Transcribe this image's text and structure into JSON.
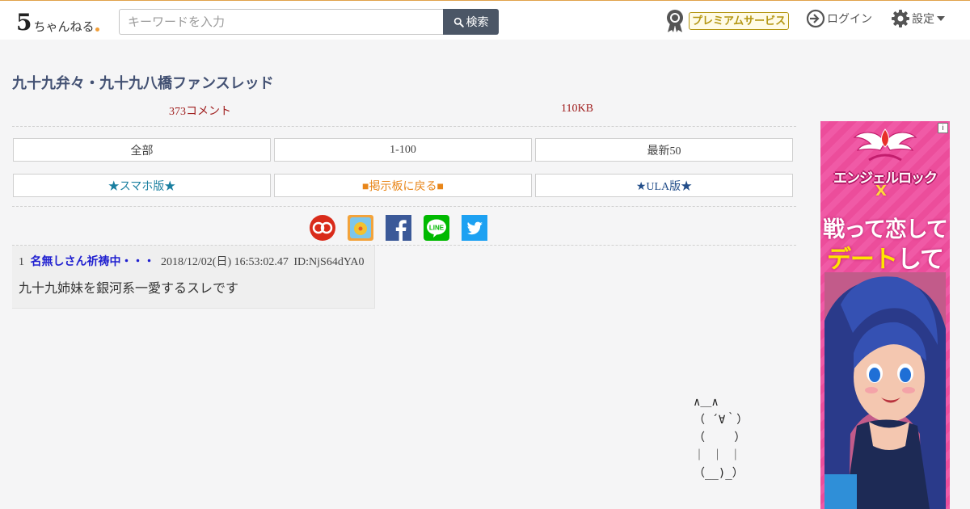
{
  "header": {
    "logo_five": "5",
    "logo_kana": "ちゃんねる",
    "search_placeholder": "キーワードを入力",
    "search_button": "検索",
    "premium_label": "プレミアムサービス",
    "login_label": "ログイン",
    "settings_label": "設定"
  },
  "thread": {
    "title": "九十九弁々・九十九八橋ファンスレッド",
    "comment_count": "373コメント",
    "size": "110KB"
  },
  "nav": {
    "all": "全部",
    "range": "1-100",
    "latest": "最新50",
    "smartphone": "★スマホ版★",
    "back_to_board": "■掲示板に戻る■",
    "ula": "★ULA版★"
  },
  "share_icons": [
    "sumatome-icon",
    "matome-icon",
    "facebook-icon",
    "line-icon",
    "twitter-icon"
  ],
  "posts": [
    {
      "number": "1",
      "name": "名無しさん祈祷中・・・",
      "date": "2018/12/02(日) 16:53:02.47",
      "id": "ID:NjS64dYA0",
      "body": "九十九姉妹を銀河系一愛するスレです"
    }
  ],
  "ascii_art": "∧＿∧\n（ ´∀｀）\n（　　 ）\n｜ ｜ ｜\n（__)_）",
  "ad": {
    "info": "i",
    "game_title": "エンジェルロック",
    "game_title_x": "X",
    "copy_line1": "戦って恋して",
    "copy_line2_highlight": "デート",
    "copy_line2_rest": "して"
  },
  "colors": {
    "accent_line": "#e0a24a",
    "title": "#435173",
    "meta_red": "#a01f1f",
    "post_name": "#1f1fd0",
    "search_button": "#4b5666",
    "premium": "#b49612",
    "ad_pink": "#ec4d9b"
  }
}
